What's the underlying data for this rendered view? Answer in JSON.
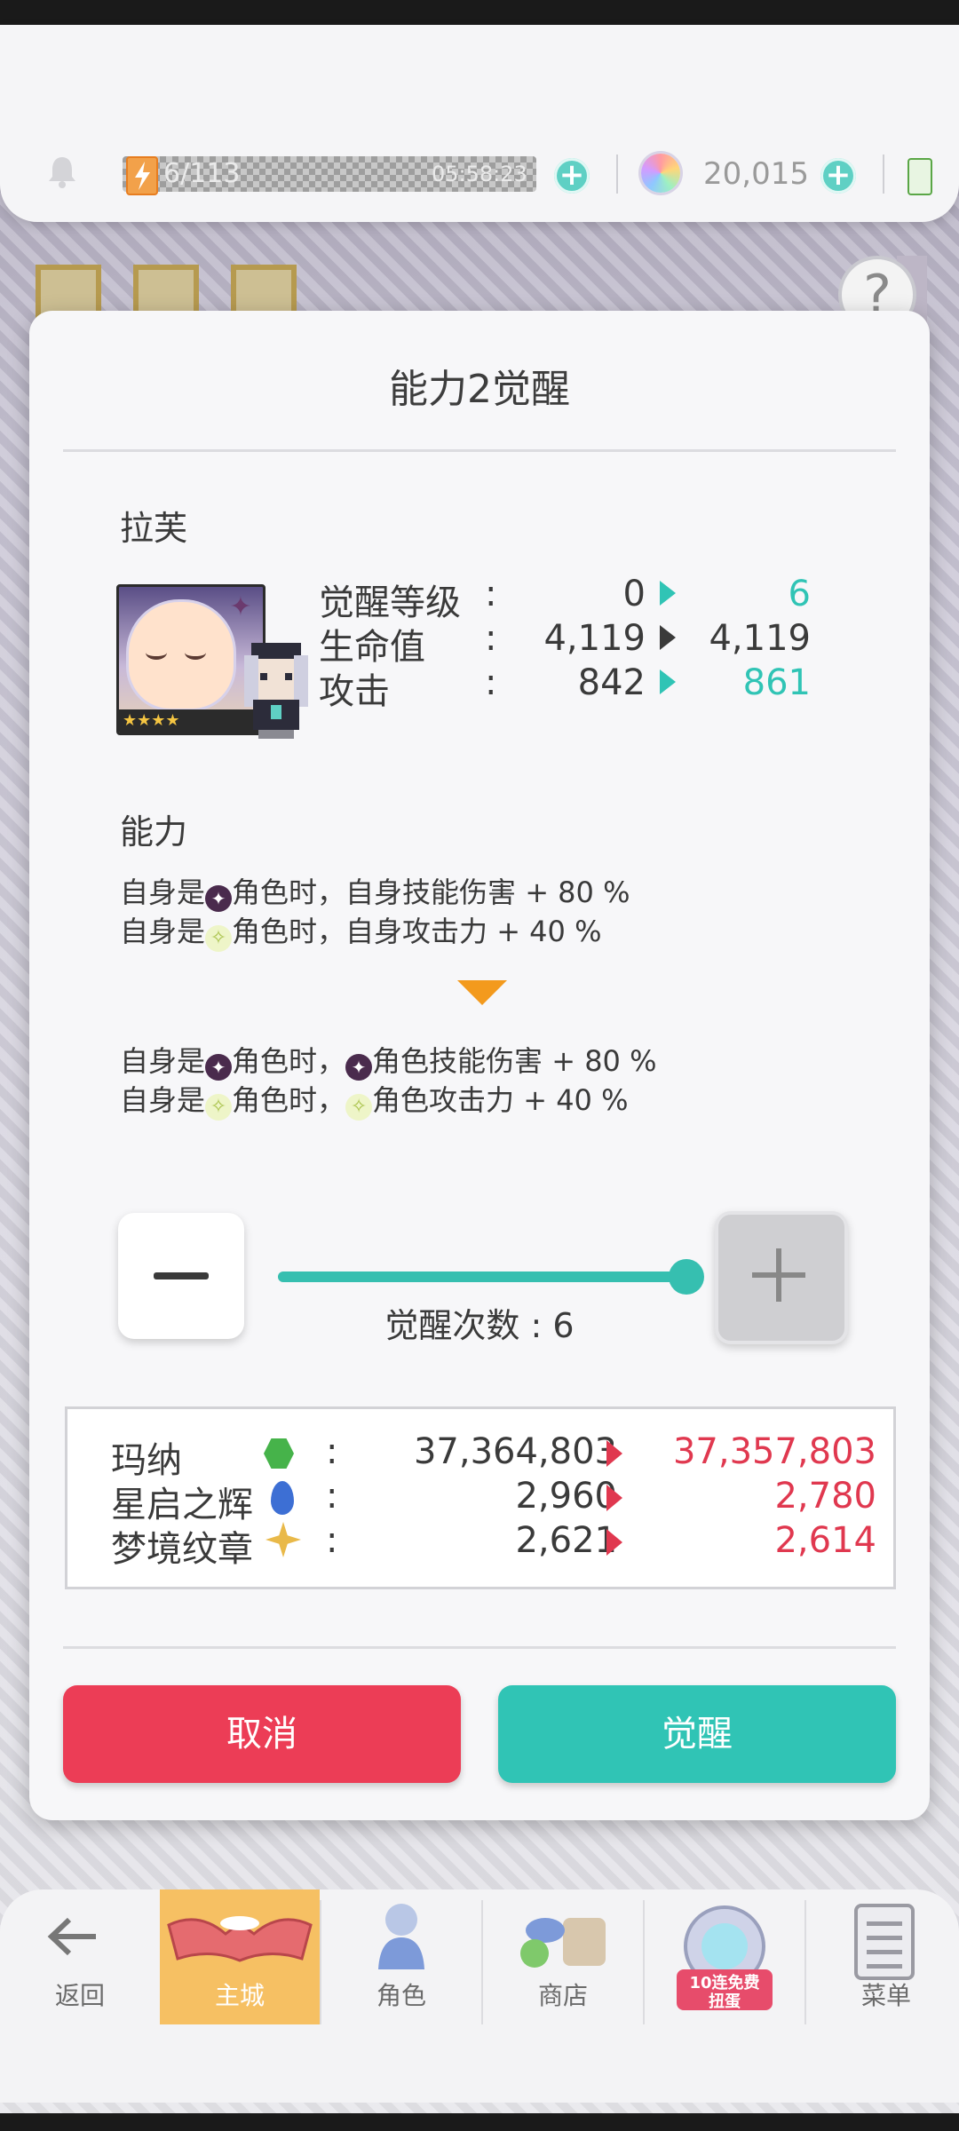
{
  "status_bar": {
    "energy": "6/113",
    "timer": "05:58:23",
    "gems": "20,015"
  },
  "dialog": {
    "title": "能力2觉醒",
    "character_name": "拉芙",
    "portrait_stars": "★★★★",
    "stats": [
      {
        "label": "觉醒等级",
        "colon": ":",
        "old": "0",
        "new": "6",
        "changed": true
      },
      {
        "label": "生命值",
        "colon": ":",
        "old": "4,119",
        "new": "4,119",
        "changed": false
      },
      {
        "label": "攻击",
        "colon": ":",
        "old": "842",
        "new": "861",
        "changed": true
      }
    ],
    "ability_title": "能力",
    "ability_before": [
      {
        "pre": "自身是",
        "icon": "dark",
        "post": "角色时，自身技能伤害 + 80 %"
      },
      {
        "pre": "自身是",
        "icon": "light",
        "post": "角色时，自身攻击力 + 40 %"
      }
    ],
    "ability_after": [
      {
        "pre": "自身是",
        "icon": "dark",
        "mid": "角色时，",
        "icon2": "dark",
        "post": "角色技能伤害 + 80 %"
      },
      {
        "pre": "自身是",
        "icon": "light",
        "mid": "角色时，",
        "icon2": "light",
        "post": "角色攻击力 + 40 %"
      }
    ],
    "slider": {
      "value": 6,
      "max": 6
    },
    "count_label": "觉醒次数 : 6",
    "costs": [
      {
        "name": "玛纳",
        "gem": "green",
        "colon": ":",
        "old": "37,364,803",
        "new": "37,357,803"
      },
      {
        "name": "星启之辉",
        "gem": "blue",
        "colon": ":",
        "old": "2,960",
        "new": "2,780"
      },
      {
        "name": "梦境纹章",
        "gem": "star",
        "colon": ":",
        "old": "2,621",
        "new": "2,614"
      }
    ],
    "cancel_label": "取消",
    "awaken_label": "觉醒"
  },
  "nav": [
    {
      "label": "返回",
      "icon": "back-arrow-icon"
    },
    {
      "label": "主城",
      "icon": "castle-icon",
      "active": true
    },
    {
      "label": "角色",
      "icon": "character-icon"
    },
    {
      "label": "商店",
      "icon": "shop-icon"
    },
    {
      "label": "",
      "icon": "gacha-icon",
      "badge": "10连免费扭蛋"
    },
    {
      "label": "菜单",
      "icon": "menu-icon"
    }
  ],
  "colors": {
    "accent": "#30c4b5",
    "cancel": "#ec3d56",
    "decrease": "#e0384f",
    "arrow": "#f39a1d"
  }
}
